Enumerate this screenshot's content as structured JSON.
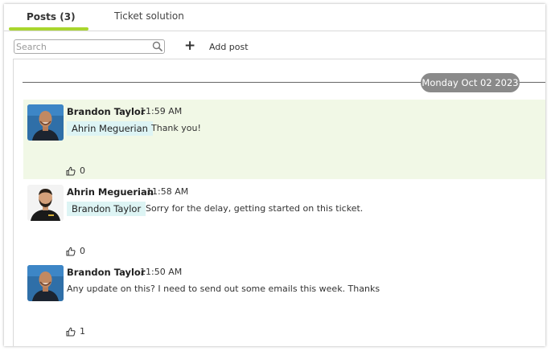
{
  "tabs": [
    {
      "label": "Posts (3)",
      "active": true
    },
    {
      "label": "Ticket solution",
      "active": false
    }
  ],
  "accent_color": "#a9d62e",
  "toolbar": {
    "search_placeholder": "Search",
    "add_post_label": "Add post"
  },
  "feed": {
    "date_label": "Monday Oct 02 2023",
    "posts": [
      {
        "author": "Brandon Taylor",
        "time": "11:59 AM",
        "mention": "Ahrin Meguerian",
        "message": "Thank you!",
        "likes": "0",
        "highlighted": true,
        "avatar": "avatar-bald-man"
      },
      {
        "author": "Ahrin Meguerian",
        "time": "11:58 AM",
        "mention": "Brandon Taylor",
        "message": "Sorry for the delay, getting started on this ticket.",
        "likes": "0",
        "highlighted": false,
        "avatar": "avatar-bearded-man"
      },
      {
        "author": "Brandon Taylor",
        "time": "11:50 AM",
        "mention": "",
        "message": "Any update on this? I need to send out some emails this week. Thanks",
        "likes": "1",
        "highlighted": false,
        "avatar": "avatar-bald-man"
      }
    ]
  }
}
